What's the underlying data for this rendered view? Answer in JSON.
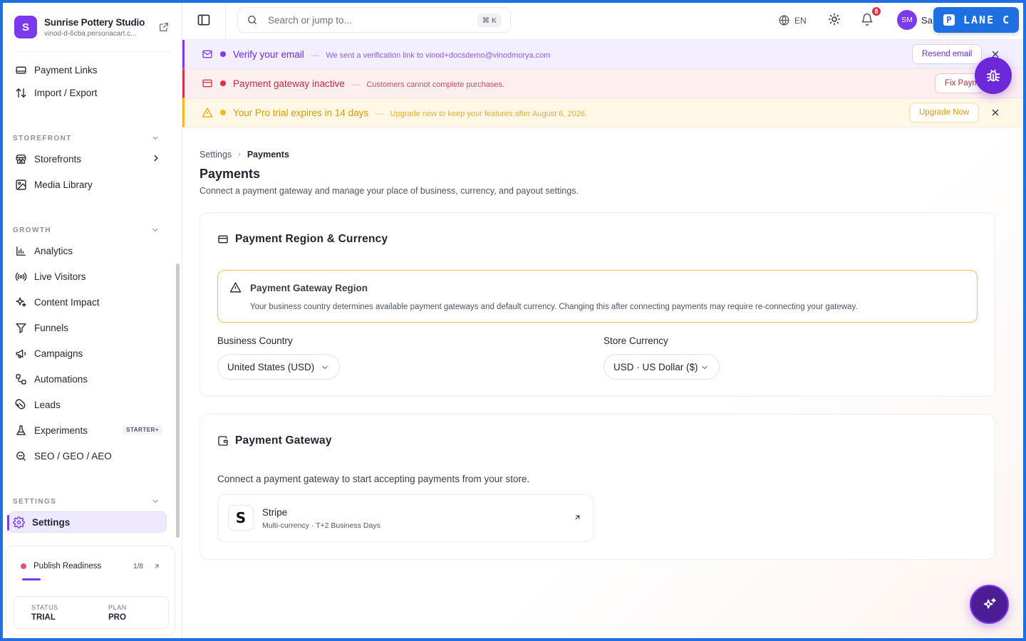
{
  "brand": {
    "initial": "S",
    "name": "Sunrise Pottery Studio",
    "subdomain": "vinod-d-6cba.personacart.c..."
  },
  "sidebar": {
    "top_items": [
      {
        "label": "Payment Links",
        "icon": "link-icon"
      },
      {
        "label": "Import / Export",
        "icon": "sort-arrows-icon"
      }
    ],
    "storefront": {
      "label": "STOREFRONT",
      "items": [
        {
          "label": "Storefronts"
        },
        {
          "label": "Media Library"
        }
      ]
    },
    "growth": {
      "label": "GROWTH",
      "items": [
        {
          "label": "Analytics"
        },
        {
          "label": "Live Visitors"
        },
        {
          "label": "Content Impact"
        },
        {
          "label": "Funnels"
        },
        {
          "label": "Campaigns"
        },
        {
          "label": "Automations"
        },
        {
          "label": "Leads"
        },
        {
          "label": "Experiments",
          "badge": "STARTER+"
        },
        {
          "label": "SEO / GEO / AEO"
        }
      ]
    },
    "settings": {
      "label": "SETTINGS",
      "items": [
        {
          "label": "Settings",
          "active": true
        }
      ]
    },
    "readiness": {
      "label": "Publish Readiness",
      "count": "1/8",
      "progress": 0.125
    },
    "plan": {
      "status_label": "STATUS",
      "status_value": "TRIAL",
      "plan_label": "PLAN",
      "plan_value": "PRO"
    }
  },
  "topbar": {
    "search_placeholder": "Search or jump to...",
    "shortcut": "⌘ K",
    "language": "EN",
    "notifications": "8",
    "avatar_initials": "SM",
    "user_name": "Sa",
    "lane_badge": {
      "letter": "P",
      "text": "LANE C"
    }
  },
  "banners": {
    "verify": {
      "title": "Verify your email",
      "sep": "—",
      "message": "We sent a verification link to vinod+docsdemo@vinodmorya.com",
      "button": "Resend email"
    },
    "gateway": {
      "title": "Payment gateway inactive",
      "sep": "—",
      "message": "Customers cannot complete purchases.",
      "button": "Fix Payme"
    },
    "trial": {
      "title": "Your Pro trial expires in 14 days",
      "sep": "—",
      "message": "Upgrade now to keep your features after August 6, 2026.",
      "button": "Upgrade Now"
    }
  },
  "page": {
    "breadcrumb": {
      "parent": "Settings",
      "current": "Payments"
    },
    "title": "Payments",
    "subtitle": "Connect a payment gateway and manage your place of business, currency, and payout settings."
  },
  "region_card": {
    "title": "Payment Region & Currency",
    "alert_title": "Payment Gateway Region",
    "alert_text": "Your business country determines available payment gateways and default currency. Changing this after connecting payments may require re-connecting your gateway.",
    "country_label": "Business Country",
    "country_value": "United States (USD)",
    "currency_label": "Store Currency",
    "currency_value": "USD · US Dollar ($)"
  },
  "gateway_card": {
    "title": "Payment Gateway",
    "description": "Connect a payment gateway to start accepting payments from your store.",
    "stripe": {
      "logo": "S",
      "name": "Stripe",
      "meta": "Multi-currency · T+2 Business Days"
    }
  },
  "colors": {
    "accent": "#7c3aed",
    "danger": "#d9344e",
    "warning": "#f5b81c",
    "lane": "#1e6fe0"
  }
}
